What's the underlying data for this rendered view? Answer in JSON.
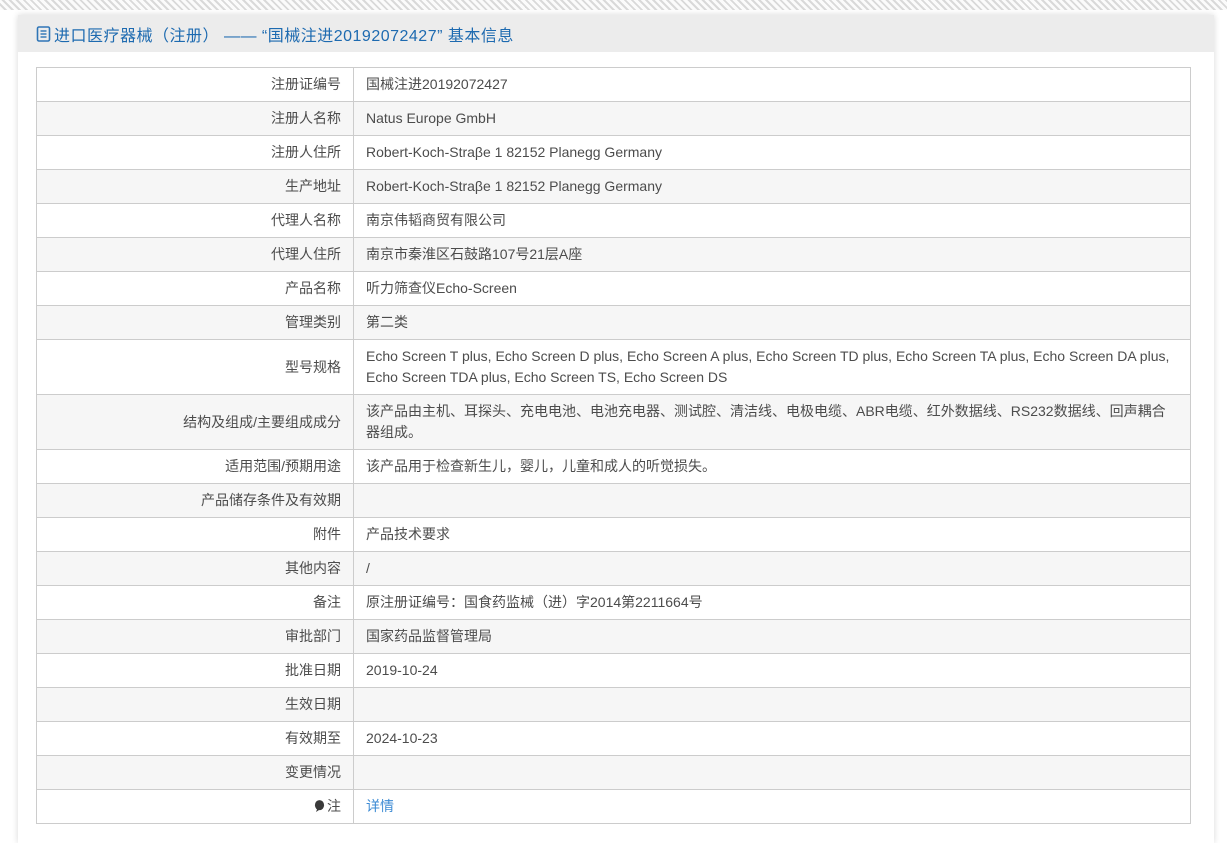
{
  "header": {
    "icon": "document-icon",
    "title": "进口医疗器械（注册） —— “国械注进20192072427” 基本信息",
    "title_color": "#1d6ab0"
  },
  "link_color": "#3d8bd4",
  "table": {
    "rows": [
      {
        "label": "注册证编号",
        "value": "国械注进20192072427"
      },
      {
        "label": "注册人名称",
        "value": "Natus Europe GmbH"
      },
      {
        "label": "注册人住所",
        "value": "Robert-Koch-Straβe 1 82152 Planegg Germany"
      },
      {
        "label": "生产地址",
        "value": "Robert-Koch-Straβe 1 82152 Planegg Germany"
      },
      {
        "label": "代理人名称",
        "value": "南京伟韬商贸有限公司"
      },
      {
        "label": "代理人住所",
        "value": "南京市秦淮区石鼓路107号21层A座"
      },
      {
        "label": "产品名称",
        "value": "听力筛查仪Echo-Screen"
      },
      {
        "label": "管理类别",
        "value": "第二类"
      },
      {
        "label": "型号规格",
        "value": "Echo Screen T plus, Echo Screen D plus, Echo Screen A plus, Echo Screen TD plus, Echo Screen TA plus, Echo Screen DA plus, Echo Screen TDA plus, Echo Screen TS, Echo Screen DS"
      },
      {
        "label": "结构及组成/主要组成成分",
        "value": "该产品由主机、耳探头、充电电池、电池充电器、测试腔、清洁线、电极电缆、ABR电缆、红外数据线、RS232数据线、回声耦合器组成。"
      },
      {
        "label": "适用范围/预期用途",
        "value": "该产品用于检查新生儿，婴儿，儿童和成人的听觉损失。"
      },
      {
        "label": "产品储存条件及有效期",
        "value": ""
      },
      {
        "label": "附件",
        "value": "产品技术要求"
      },
      {
        "label": "其他内容",
        "value": "/"
      },
      {
        "label": "备注",
        "value": "原注册证编号：国食药监械（进）字2014第2211664号"
      },
      {
        "label": "审批部门",
        "value": "国家药品监督管理局"
      },
      {
        "label": "批准日期",
        "value": "2019-10-24"
      },
      {
        "label": "生效日期",
        "value": ""
      },
      {
        "label": "有效期至",
        "value": "2024-10-23"
      },
      {
        "label": "变更情况",
        "value": ""
      },
      {
        "label": "注",
        "icon": "note-balloon-icon",
        "value": "详情",
        "link": true
      }
    ]
  }
}
